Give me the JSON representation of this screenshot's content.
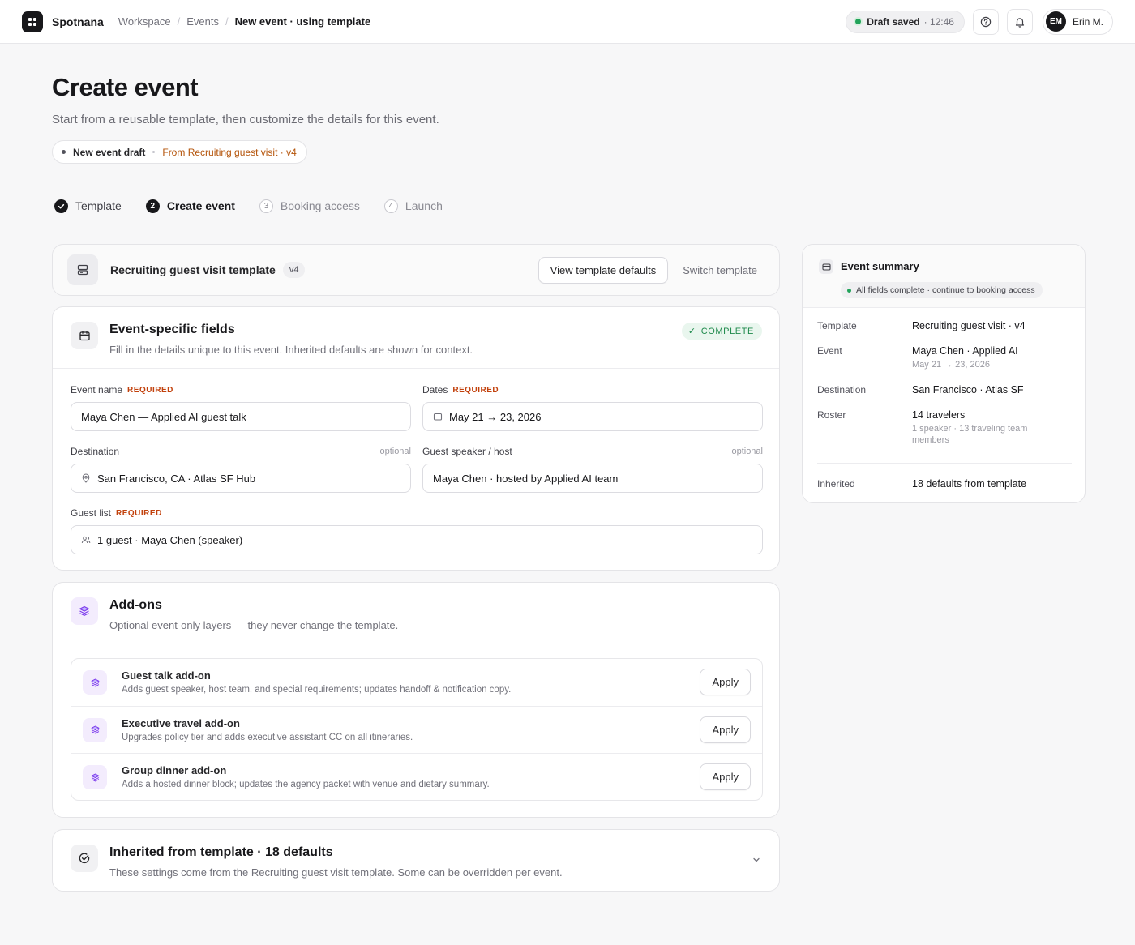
{
  "app": {
    "brand": "Spotnana",
    "user_initials": "EM",
    "user_name": "Erin M."
  },
  "breadcrumb": [
    "Workspace",
    "Events",
    "New event · using template"
  ],
  "draft_status": {
    "label": "Draft saved",
    "time": "· 12:46"
  },
  "header": {
    "title": "Create event",
    "subtitle": "Start from a reusable template, then customize the details for this event.",
    "draft_tag": "New event draft",
    "draft_source": "From Recruiting guest visit · v4"
  },
  "steps": [
    {
      "num": "",
      "label": "Template",
      "state": "done"
    },
    {
      "num": "2",
      "label": "Create event",
      "state": "active"
    },
    {
      "num": "3",
      "label": "Booking access",
      "state": "todo"
    },
    {
      "num": "4",
      "label": "Launch",
      "state": "todo"
    }
  ],
  "template_card": {
    "name": "Recruiting guest visit template",
    "version": "v4",
    "view_defaults": "View template defaults",
    "switch": "Switch template"
  },
  "fields_section": {
    "title": "Event-specific fields",
    "description": "Fill in the details unique to this event. Inherited defaults are shown for context.",
    "status": "COMPLETE",
    "required_label": "REQUIRED",
    "optional_label": "optional",
    "event_name": {
      "label": "Event name",
      "value": "Maya Chen — Applied AI guest talk"
    },
    "dates": {
      "label": "Dates",
      "value": "May 21 → 23, 2026"
    },
    "destination": {
      "label": "Destination",
      "value": "San Francisco, CA · Atlas SF Hub"
    },
    "speaker": {
      "label": "Guest speaker / host",
      "value": "Maya Chen · hosted by Applied AI team"
    },
    "guest_list": {
      "label": "Guest list",
      "value": "1 guest · Maya Chen (speaker)"
    }
  },
  "addons_section": {
    "title": "Add-ons",
    "description": "Optional event-only layers — they never change the template.",
    "apply_label": "Apply",
    "items": [
      {
        "title": "Guest talk add-on",
        "desc": "Adds guest speaker, host team, and special requirements; updates handoff & notification copy."
      },
      {
        "title": "Executive travel add-on",
        "desc": "Upgrades policy tier and adds executive assistant CC on all itineraries."
      },
      {
        "title": "Group dinner add-on",
        "desc": "Adds a hosted dinner block; updates the agency packet with venue and dietary summary."
      }
    ]
  },
  "inherited_section": {
    "title": "Inherited from template · 18 defaults",
    "description": "These settings come from the Recruiting guest visit template. Some can be overridden per event."
  },
  "summary": {
    "title": "Event summary",
    "status": "All fields complete · continue to booking access",
    "rows": {
      "template": {
        "key": "Template",
        "value": "Recruiting guest visit · v4"
      },
      "event": {
        "key": "Event",
        "value": "Maya Chen · Applied AI",
        "sub": "May 21 → 23, 2026"
      },
      "destination": {
        "key": "Destination",
        "value": "San Francisco · Atlas SF"
      },
      "roster": {
        "key": "Roster",
        "value": "14 travelers",
        "sub": "1 speaker · 13 traveling team members"
      },
      "inherited": {
        "key": "Inherited",
        "value": "18 defaults from template"
      }
    }
  },
  "colors": {
    "accent": "#18181b",
    "success": "#22a35a",
    "required": "#c2410c",
    "addon_icon": "#7c3aed",
    "source_tag": "#b45309"
  }
}
